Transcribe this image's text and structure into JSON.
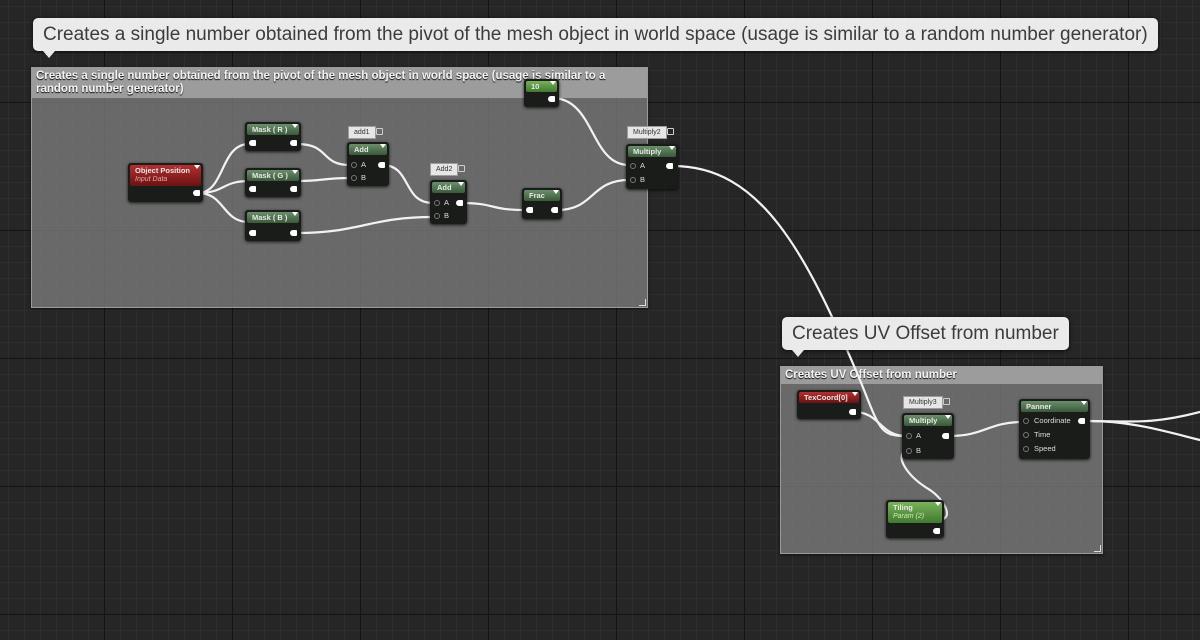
{
  "comment_bubble_1": "Creates a single number obtained from the pivot of the mesh object in world space (usage is similar to a random number generator)",
  "comment_bubble_2": "Creates UV Offset from number",
  "comment_box_1": {
    "title": "Creates a single number obtained from the pivot of the mesh object in world space (usage is similar to a random number generator)"
  },
  "comment_box_2": {
    "title": "Creates UV Offset from number"
  },
  "nodes": {
    "object_position": {
      "title": "Object Position",
      "subtitle": "Input Data"
    },
    "mask_r": {
      "title": "Mask ( R )"
    },
    "mask_g": {
      "title": "Mask ( G )"
    },
    "mask_b": {
      "title": "Mask ( B )"
    },
    "add1": {
      "tag": "add1",
      "title": "Add",
      "pin_a": "A",
      "pin_b": "B"
    },
    "add2": {
      "tag": "Add2",
      "title": "Add",
      "pin_a": "A",
      "pin_b": "B"
    },
    "frac": {
      "title": "Frac"
    },
    "const10": {
      "title": "10"
    },
    "multiply2": {
      "tag": "Multiply2",
      "title": "Multiply",
      "pin_a": "A",
      "pin_b": "B"
    },
    "texcoord": {
      "title": "TexCoord[0]"
    },
    "multiply3": {
      "tag": "Multiply3",
      "title": "Multiply",
      "pin_a": "A",
      "pin_b": "B"
    },
    "panner": {
      "title": "Panner",
      "pin_coordinate": "Coordinate",
      "pin_time": "Time",
      "pin_speed": "Speed"
    },
    "tiling": {
      "title": "Tiling",
      "subtitle": "Param (2)"
    }
  },
  "colors": {
    "background": "#262626",
    "node_header_green": "#3a5a3a",
    "node_header_red": "#6a1212",
    "param_header": "#3f7a30",
    "comment_bubble": "#eaeaea",
    "wire": "#ffffff"
  }
}
